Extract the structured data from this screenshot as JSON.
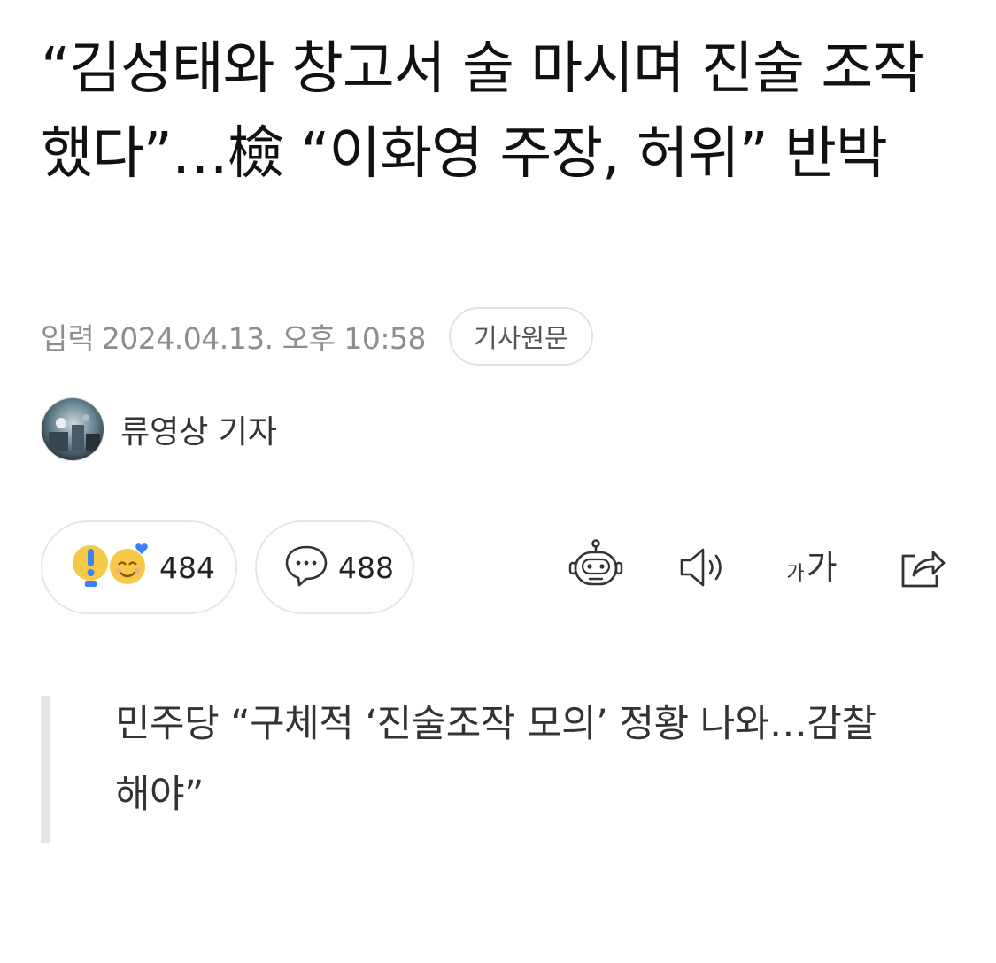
{
  "article": {
    "headline": "“김성태와 창고서 술 마시며 진술 조작했다”…檢 “이화영 주장, 허위” 반박",
    "date_label": "입력",
    "date_value": "2024.04.13. 오후 10:58",
    "original_button": "기사원문",
    "reporter": "류영상 기자",
    "subtitle": "민주당 “구체적 ‘진술조작 모의’ 정황 나와…감찰해야”"
  },
  "actions": {
    "reaction_count": "484",
    "comment_count": "488"
  },
  "icons": {
    "reaction": [
      "exclamation-emoji-icon",
      "heart-smile-emoji-icon"
    ],
    "comment": "speech-bubble-icon",
    "summary_bot": "robot-icon",
    "tts": "speaker-icon",
    "font_size": "font-size-icon",
    "share": "share-icon"
  },
  "colors": {
    "text": "#111111",
    "meta": "#8e8e8e",
    "border": "#e2e2e2",
    "quote_bar": "#e4e4e4",
    "emoji_yellow": "#f7c948",
    "emoji_blue": "#3b82f6"
  }
}
